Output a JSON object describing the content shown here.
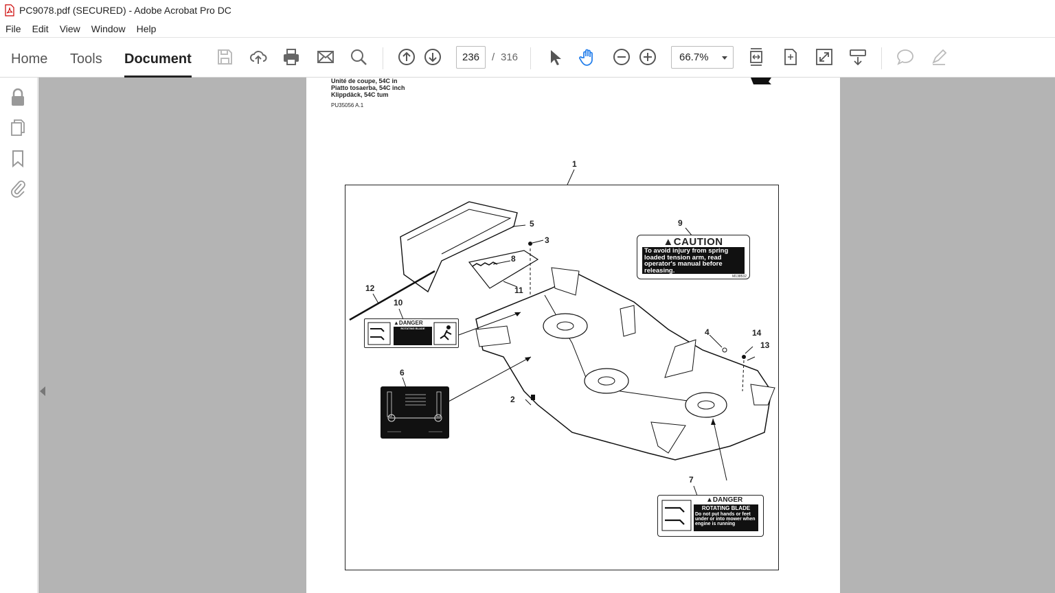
{
  "window": {
    "title": "PC9078.pdf (SECURED) - Adobe Acrobat Pro DC"
  },
  "menu": [
    "File",
    "Edit",
    "View",
    "Window",
    "Help"
  ],
  "tabs": {
    "home": "Home",
    "tools": "Tools",
    "document": "Document"
  },
  "navigation": {
    "current_page": "236",
    "separator": "/",
    "total_pages": "316",
    "zoom": "66.7%"
  },
  "page": {
    "header_lines": [
      "Unité de coupe, 54C in",
      "Piatto tosaerba, 54C inch",
      "Klippdäck, 54C tum"
    ],
    "doc_code": "PU35056 A.1",
    "callouts": [
      "1",
      "2",
      "3",
      "4",
      "5",
      "6",
      "7",
      "8",
      "9",
      "10",
      "11",
      "12",
      "13",
      "14"
    ],
    "caution_decal": {
      "heading": "CAUTION",
      "text": "To avoid injury from spring loaded tension arm, read operator's manual before releasing.",
      "part": "M138532"
    },
    "danger_decal_7": {
      "heading": "DANGER",
      "subheading": "ROTATING BLADE",
      "text": "Do not put hands or feet under or into mower when engine is running"
    },
    "danger_decal_10": {
      "heading": "DANGER",
      "subheading": "ROTATING BLADE"
    }
  },
  "colors": {
    "viewer_bg": "#b4b4b4",
    "toolbar_bg": "#ffffff",
    "accent_icon": "#2680eb"
  }
}
